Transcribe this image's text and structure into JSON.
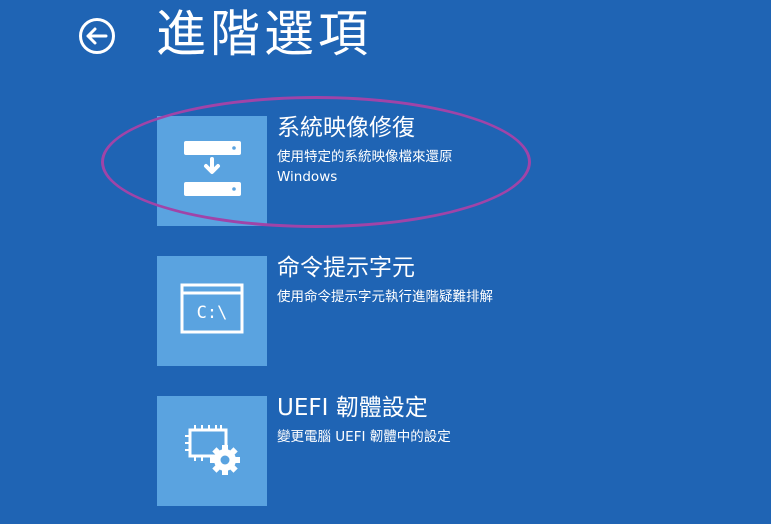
{
  "header": {
    "title": "進階選項",
    "back_icon": "back-arrow-icon"
  },
  "options": [
    {
      "title": "系統映像修復",
      "description_line1": "使用特定的系統映像檔來還原",
      "description_line2": "Windows",
      "icon": "system-image-icon"
    },
    {
      "title": "命令提示字元",
      "description_line1": "使用命令提示字元執行進階疑難排解",
      "icon": "command-prompt-icon",
      "icon_text": "C:\\"
    },
    {
      "title": "UEFI 韌體設定",
      "description_line1": "變更電腦 UEFI 韌體中的設定",
      "icon": "firmware-settings-icon"
    }
  ],
  "colors": {
    "background": "#1f64b4",
    "tile": "#5aa3e0",
    "highlight": "#a044a8"
  }
}
